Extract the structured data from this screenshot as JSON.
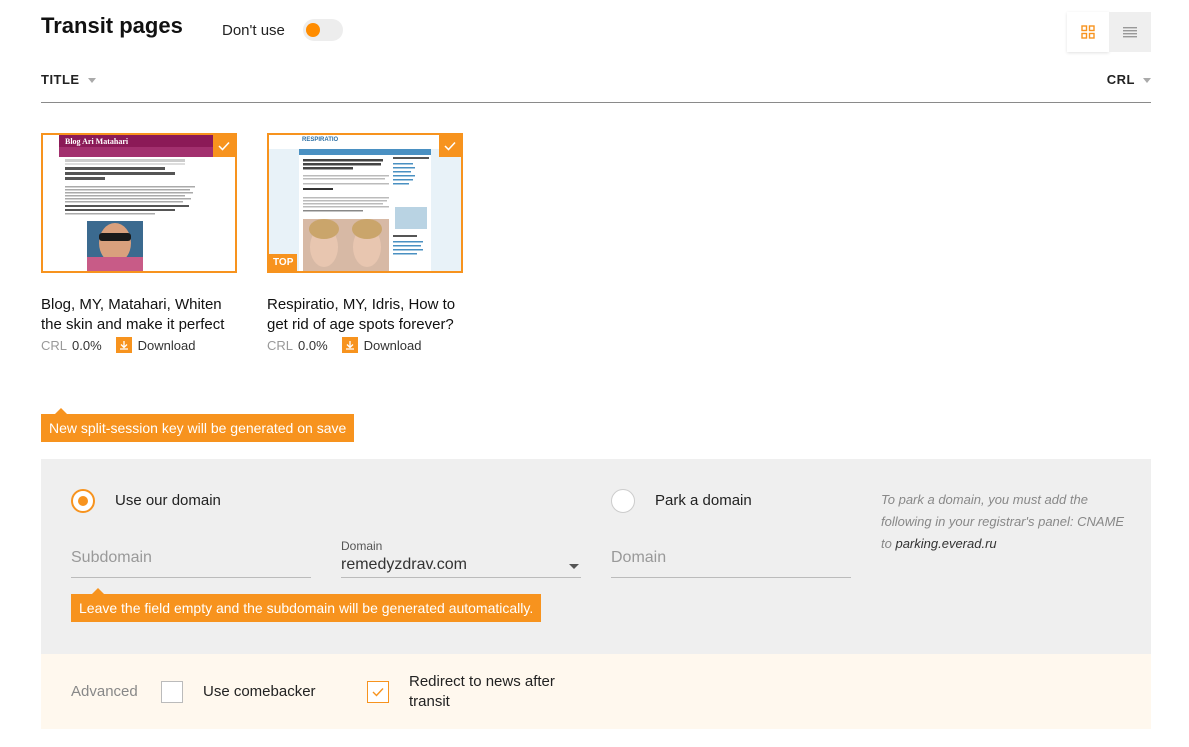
{
  "header": {
    "title": "Transit pages",
    "dont_use_label": "Don't use"
  },
  "sortbar": {
    "title_label": "TITLE",
    "crl_label": "CRL"
  },
  "cards": [
    {
      "thumb_header": "Blog Ari Matahari",
      "title": "Blog, MY, Matahari, Whiten the skin and make it perfect",
      "crl_label": "CRL",
      "crl_value": "0.0%",
      "download_label": "Download"
    },
    {
      "thumb_header": "RESPIRATIO",
      "badge": "TOP",
      "title": "Respiratio, MY, Idris, How to get rid of age spots forever?",
      "crl_label": "CRL",
      "crl_value": "0.0%",
      "download_label": "Download"
    }
  ],
  "tips": {
    "split_session": "New split-session key will be generated on save",
    "subdomain": "Leave the field empty and the subdomain will be generated automatically."
  },
  "domain": {
    "use_our_domain_label": "Use our domain",
    "park_domain_label": "Park a domain",
    "subdomain_placeholder": "Subdomain",
    "domain_select_label": "Domain",
    "domain_select_value": "remedyzdrav.com",
    "park_domain_placeholder": "Domain",
    "park_note_text": "To park a domain, you must add the following in your registrar's panel: CNAME to ",
    "park_note_value": "parking.everad.ru"
  },
  "advanced": {
    "label": "Advanced",
    "comebacker_label": "Use comebacker",
    "redirect_label": "Redirect to news after transit"
  },
  "colors": {
    "accent": "#f7931e",
    "panel_bg": "#efefef",
    "advanced_bg": "#fff8ee"
  }
}
